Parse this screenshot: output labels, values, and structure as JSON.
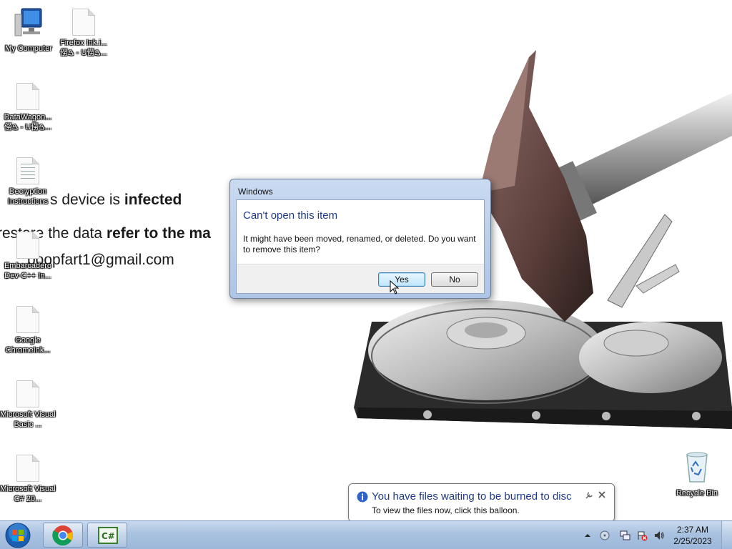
{
  "wallpaper": {
    "line1": "s device is ",
    "line1_bold": "infected",
    "line2": "restore the data ",
    "line2_bold": "refer to the ma",
    "line3": "poopfart1@gmail.com"
  },
  "desktop_icons": [
    {
      "label": "My Computer"
    },
    {
      "label": "Firefox Ink.i... 僗ࠁ - U僗ࠁ..."
    },
    {
      "label": "DataWagon... 僗ࠁ - U僗ࠁ..."
    },
    {
      "label": "Decryption Instructions"
    },
    {
      "label": "Embarcadero Dev-C++ In..."
    },
    {
      "label": "Google ChromeInk..."
    },
    {
      "label": "Microsoft Visual Basic ..."
    },
    {
      "label": "Microsoft Visual C# 20..."
    },
    {
      "label": "Recycle Bin"
    }
  ],
  "dialog": {
    "title": "Windows",
    "heading": "Can't open this item",
    "message": "It might have been moved, renamed, or deleted. Do you want to remove this item?",
    "yes_label": "Yes",
    "no_label": "No"
  },
  "balloon": {
    "title": "You have files waiting to be burned to disc",
    "text": "To view the files now, click this balloon."
  },
  "taskbar": {
    "pinned": [
      "start-orb",
      "chrome",
      "csharp-app"
    ],
    "time": "2:37 AM",
    "date": "2/25/2023"
  },
  "colors": {
    "taskbar": "#a9c2e0",
    "dialog_heading": "#1f3a8a",
    "dialog_frame": "#c9daf1"
  }
}
